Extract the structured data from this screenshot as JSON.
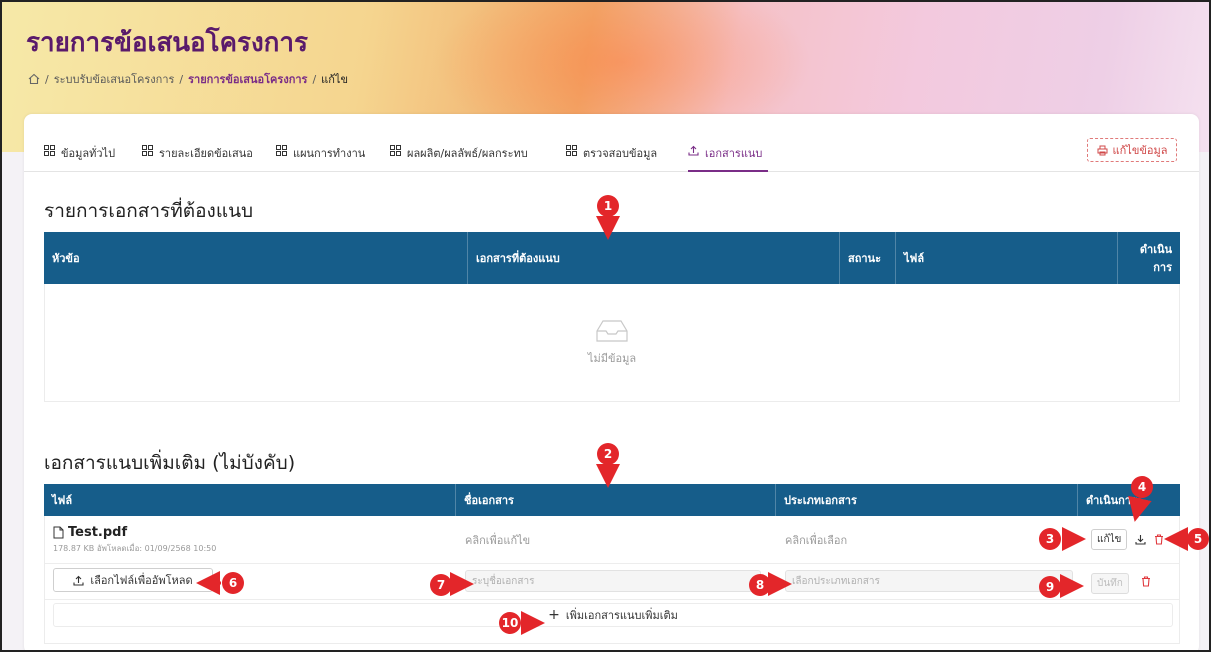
{
  "header": {
    "title": "รายการข้อเสนอโครงการ",
    "breadcrumb": {
      "sep": "/",
      "items": [
        "ระบบรับข้อเสนอโครงการ",
        "รายการข้อเสนอโครงการ",
        "แก้ไข"
      ]
    }
  },
  "tabs": [
    {
      "label": "ข้อมูลทั่วไป",
      "icon": "grid-icon"
    },
    {
      "label": "รายละเอียดข้อเสนอ",
      "icon": "grid-icon"
    },
    {
      "label": "แผนการทำงาน",
      "icon": "grid-icon"
    },
    {
      "label": "ผลผลิต/ผลลัพธ์/ผลกระทบ",
      "icon": "grid-icon"
    },
    {
      "label": "ตรวจสอบข้อมูล",
      "icon": "grid-icon"
    },
    {
      "label": "เอกสารแนบ",
      "icon": "upload-icon",
      "active": true
    }
  ],
  "edit_button": {
    "label": "แก้ไขข้อมูล",
    "icon": "printer-icon"
  },
  "required_docs": {
    "title": "รายการเอกสารที่ต้องแนบ",
    "columns": [
      "หัวข้อ",
      "เอกสารที่ต้องแนบ",
      "สถานะ",
      "ไฟล์",
      "ดำเนิน",
      "การ"
    ],
    "empty_text": "ไม่มีข้อมูล"
  },
  "extra_docs": {
    "title": "เอกสารแนบเพิ่มเติม (ไม่บังคับ)",
    "columns": [
      "ไฟล์",
      "ชื่อเอกสาร",
      "ประเภทเอกสาร",
      "ดำเนินการ"
    ],
    "row": {
      "file_name": "Test.pdf",
      "file_meta": "178.87 KB อัพโหลดเมื่อ: 01/09/2568 10:50",
      "doc_name": "คลิกเพื่อแก้ไข",
      "doc_type": "คลิกเพื่อเลือก",
      "edit_label": "แก้ไข"
    },
    "new_row": {
      "upload_label": "เลือกไฟล์เพื่ออัพโหลด",
      "name_placeholder": "ระบุชื่อเอกสาร",
      "type_placeholder": "เลือกประเภทเอกสาร",
      "save_label": "บันทึก"
    },
    "add_more_label": "เพิ่มเอกสารแนบเพิ่มเติม"
  },
  "markers": [
    "1",
    "2",
    "3",
    "4",
    "5",
    "6",
    "7",
    "8",
    "9",
    "10"
  ],
  "colors": {
    "brand": "#5a1a6b",
    "table_header": "#165d8a",
    "marker": "#e3262a",
    "danger": "#d04848"
  }
}
